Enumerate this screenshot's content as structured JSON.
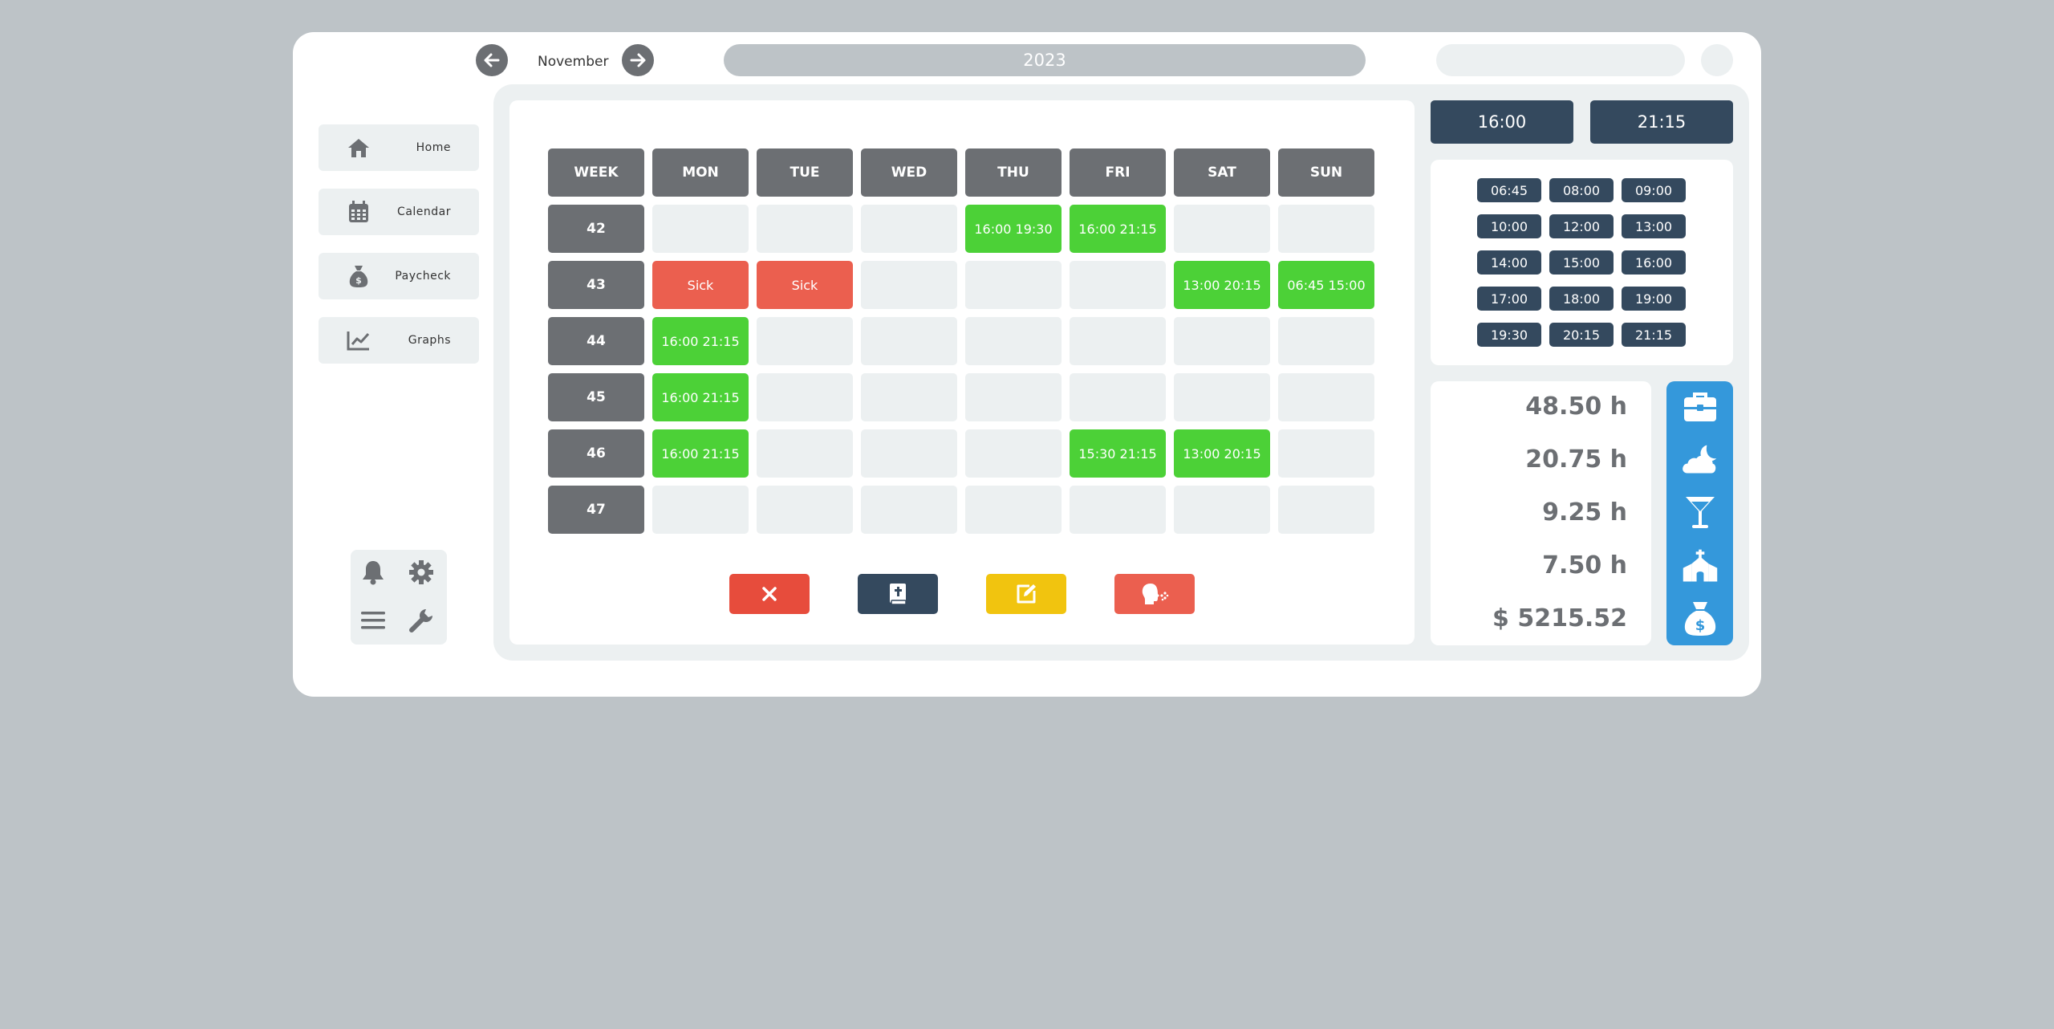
{
  "header": {
    "month": "November",
    "year": "2023"
  },
  "sidebar": {
    "items": [
      {
        "label": "Home",
        "icon": "home-icon"
      },
      {
        "label": "Calendar",
        "icon": "calendar-icon"
      },
      {
        "label": "Paycheck",
        "icon": "money-bag-icon"
      },
      {
        "label": "Graphs",
        "icon": "chart-line-icon"
      }
    ]
  },
  "calendar": {
    "headers": [
      "WEEK",
      "MON",
      "TUE",
      "WED",
      "THU",
      "FRI",
      "SAT",
      "SUN"
    ],
    "weeks": [
      {
        "week": "42",
        "days": [
          {
            "text": "",
            "status": "empty"
          },
          {
            "text": "",
            "status": "empty"
          },
          {
            "text": "",
            "status": "empty"
          },
          {
            "text": "16:00 19:30",
            "status": "shift"
          },
          {
            "text": "16:00 21:15",
            "status": "shift"
          },
          {
            "text": "",
            "status": "empty"
          },
          {
            "text": "",
            "status": "empty"
          }
        ]
      },
      {
        "week": "43",
        "days": [
          {
            "text": "Sick",
            "status": "sick"
          },
          {
            "text": "Sick",
            "status": "sick"
          },
          {
            "text": "",
            "status": "empty"
          },
          {
            "text": "",
            "status": "empty"
          },
          {
            "text": "",
            "status": "empty"
          },
          {
            "text": "13:00 20:15",
            "status": "shift"
          },
          {
            "text": "06:45 15:00",
            "status": "shift"
          }
        ]
      },
      {
        "week": "44",
        "days": [
          {
            "text": "16:00 21:15",
            "status": "shift"
          },
          {
            "text": "",
            "status": "empty"
          },
          {
            "text": "",
            "status": "empty"
          },
          {
            "text": "",
            "status": "empty"
          },
          {
            "text": "",
            "status": "empty"
          },
          {
            "text": "",
            "status": "empty"
          },
          {
            "text": "",
            "status": "empty"
          }
        ]
      },
      {
        "week": "45",
        "days": [
          {
            "text": "16:00 21:15",
            "status": "shift"
          },
          {
            "text": "",
            "status": "empty"
          },
          {
            "text": "",
            "status": "empty"
          },
          {
            "text": "",
            "status": "empty"
          },
          {
            "text": "",
            "status": "empty"
          },
          {
            "text": "",
            "status": "empty"
          },
          {
            "text": "",
            "status": "empty"
          }
        ]
      },
      {
        "week": "46",
        "days": [
          {
            "text": "16:00 21:15",
            "status": "shift"
          },
          {
            "text": "",
            "status": "empty"
          },
          {
            "text": "",
            "status": "empty"
          },
          {
            "text": "",
            "status": "empty"
          },
          {
            "text": "15:30 21:15",
            "status": "shift"
          },
          {
            "text": "13:00 20:15",
            "status": "shift"
          },
          {
            "text": "",
            "status": "empty"
          }
        ]
      },
      {
        "week": "47",
        "days": [
          {
            "text": "",
            "status": "empty"
          },
          {
            "text": "",
            "status": "empty"
          },
          {
            "text": "",
            "status": "empty"
          },
          {
            "text": "",
            "status": "empty"
          },
          {
            "text": "",
            "status": "empty"
          },
          {
            "text": "",
            "status": "empty"
          },
          {
            "text": "",
            "status": "empty"
          }
        ]
      }
    ]
  },
  "actions": [
    {
      "name": "delete",
      "icon": "close-icon",
      "color": "#e74c3c"
    },
    {
      "name": "holiday",
      "icon": "bible-icon",
      "color": "#34495e"
    },
    {
      "name": "edit",
      "icon": "edit-icon",
      "color": "#f1c40f"
    },
    {
      "name": "sick",
      "icon": "sick-head-icon",
      "color": "#eb5f4f"
    }
  ],
  "times": {
    "start": "16:00",
    "end": "21:15"
  },
  "presets": [
    "06:45",
    "08:00",
    "09:00",
    "10:00",
    "12:00",
    "13:00",
    "14:00",
    "15:00",
    "16:00",
    "17:00",
    "18:00",
    "19:00",
    "19:30",
    "20:15",
    "21:15"
  ],
  "stats": [
    {
      "value": "48.50 h",
      "icon": "briefcase-icon"
    },
    {
      "value": "20.75 h",
      "icon": "cloud-moon-icon"
    },
    {
      "value": "9.25 h",
      "icon": "cocktail-icon"
    },
    {
      "value": "7.50 h",
      "icon": "church-icon"
    },
    {
      "value": "$ 5215.52",
      "icon": "money-bag-icon"
    }
  ],
  "colors": {
    "background": "#bdc3c7",
    "shift": "#4cd137",
    "sick": "#eb5f4f",
    "dark": "#34495e",
    "accent": "#3498db"
  }
}
